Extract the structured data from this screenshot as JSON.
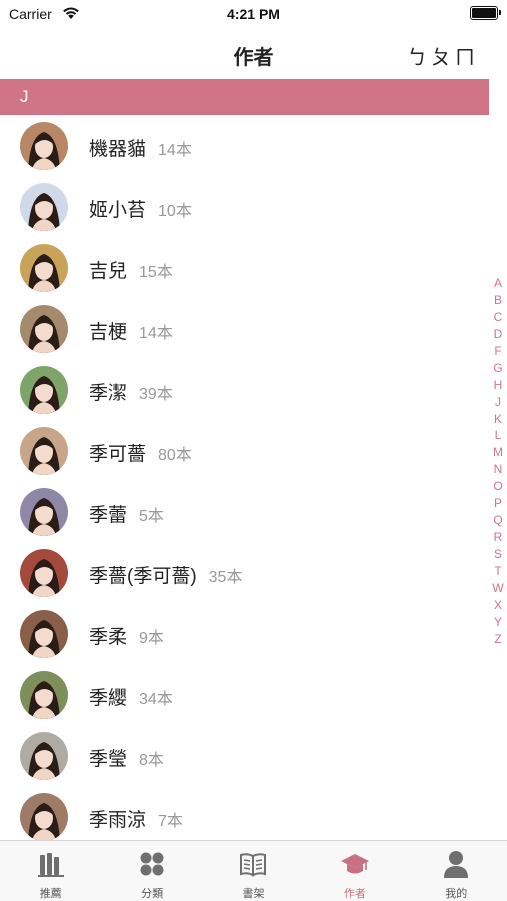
{
  "status_bar": {
    "carrier": "Carrier",
    "time": "4:21 PM"
  },
  "nav": {
    "title": "作者",
    "right_button": "ㄅㄆㄇ"
  },
  "section": {
    "letter": "J"
  },
  "authors": [
    {
      "name": "機器貓",
      "count": "14本",
      "tone": "#b88766"
    },
    {
      "name": "姬小苔",
      "count": "10本",
      "tone": "#cfd9e8"
    },
    {
      "name": "吉兒",
      "count": "15本",
      "tone": "#c9a35a"
    },
    {
      "name": "吉梗",
      "count": "14本",
      "tone": "#a58a6d"
    },
    {
      "name": "季潔",
      "count": "39本",
      "tone": "#7ea46a"
    },
    {
      "name": "季可薔",
      "count": "80本",
      "tone": "#c8a588"
    },
    {
      "name": "季蕾",
      "count": "5本",
      "tone": "#8f87a6"
    },
    {
      "name": "季薔(季可薔)",
      "count": "35本",
      "tone": "#a34a3d"
    },
    {
      "name": "季柔",
      "count": "9本",
      "tone": "#8a5f49"
    },
    {
      "name": "季纓",
      "count": "34本",
      "tone": "#7d8f5b"
    },
    {
      "name": "季瑩",
      "count": "8本",
      "tone": "#b0aaa4"
    },
    {
      "name": "季雨涼",
      "count": "7本",
      "tone": "#9d7b67"
    }
  ],
  "index_letters": [
    "A",
    "B",
    "C",
    "D",
    "F",
    "G",
    "H",
    "J",
    "K",
    "L",
    "M",
    "N",
    "O",
    "P",
    "Q",
    "R",
    "S",
    "T",
    "W",
    "X",
    "Y",
    "Z"
  ],
  "tabs": [
    {
      "label": "推薦",
      "icon": "books-icon",
      "active": false
    },
    {
      "label": "分類",
      "icon": "grid-icon",
      "active": false
    },
    {
      "label": "書架",
      "icon": "open-book-icon",
      "active": false
    },
    {
      "label": "作者",
      "icon": "graduation-cap-icon",
      "active": true
    },
    {
      "label": "我的",
      "icon": "person-icon",
      "active": false
    }
  ],
  "colors": {
    "accent": "#d07587",
    "tab_active": "#c97084",
    "tab_inactive": "#6f6f6f"
  }
}
